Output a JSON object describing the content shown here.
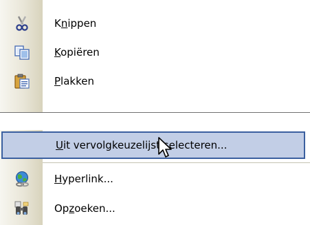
{
  "context_menu_top": {
    "items": [
      {
        "pre": "K",
        "acc": "n",
        "post": "ippen",
        "icon": "scissors-icon"
      },
      {
        "pre": "",
        "acc": "K",
        "post": "opiëren",
        "icon": "copy-icon"
      },
      {
        "pre": "",
        "acc": "P",
        "post": "lakken",
        "icon": "paste-icon"
      }
    ]
  },
  "context_menu_bottom": {
    "items": [
      {
        "pre": "",
        "acc": "U",
        "post": "it vervolgkeuzelijst selecteren...",
        "icon": "",
        "highlighted": true
      },
      {
        "pre": "",
        "acc": "H",
        "post": "yperlink...",
        "icon": "hyperlink-globe-icon"
      },
      {
        "pre": "Op",
        "acc": "z",
        "post": "oeken...",
        "icon": "research-binoculars-icon"
      }
    ]
  }
}
